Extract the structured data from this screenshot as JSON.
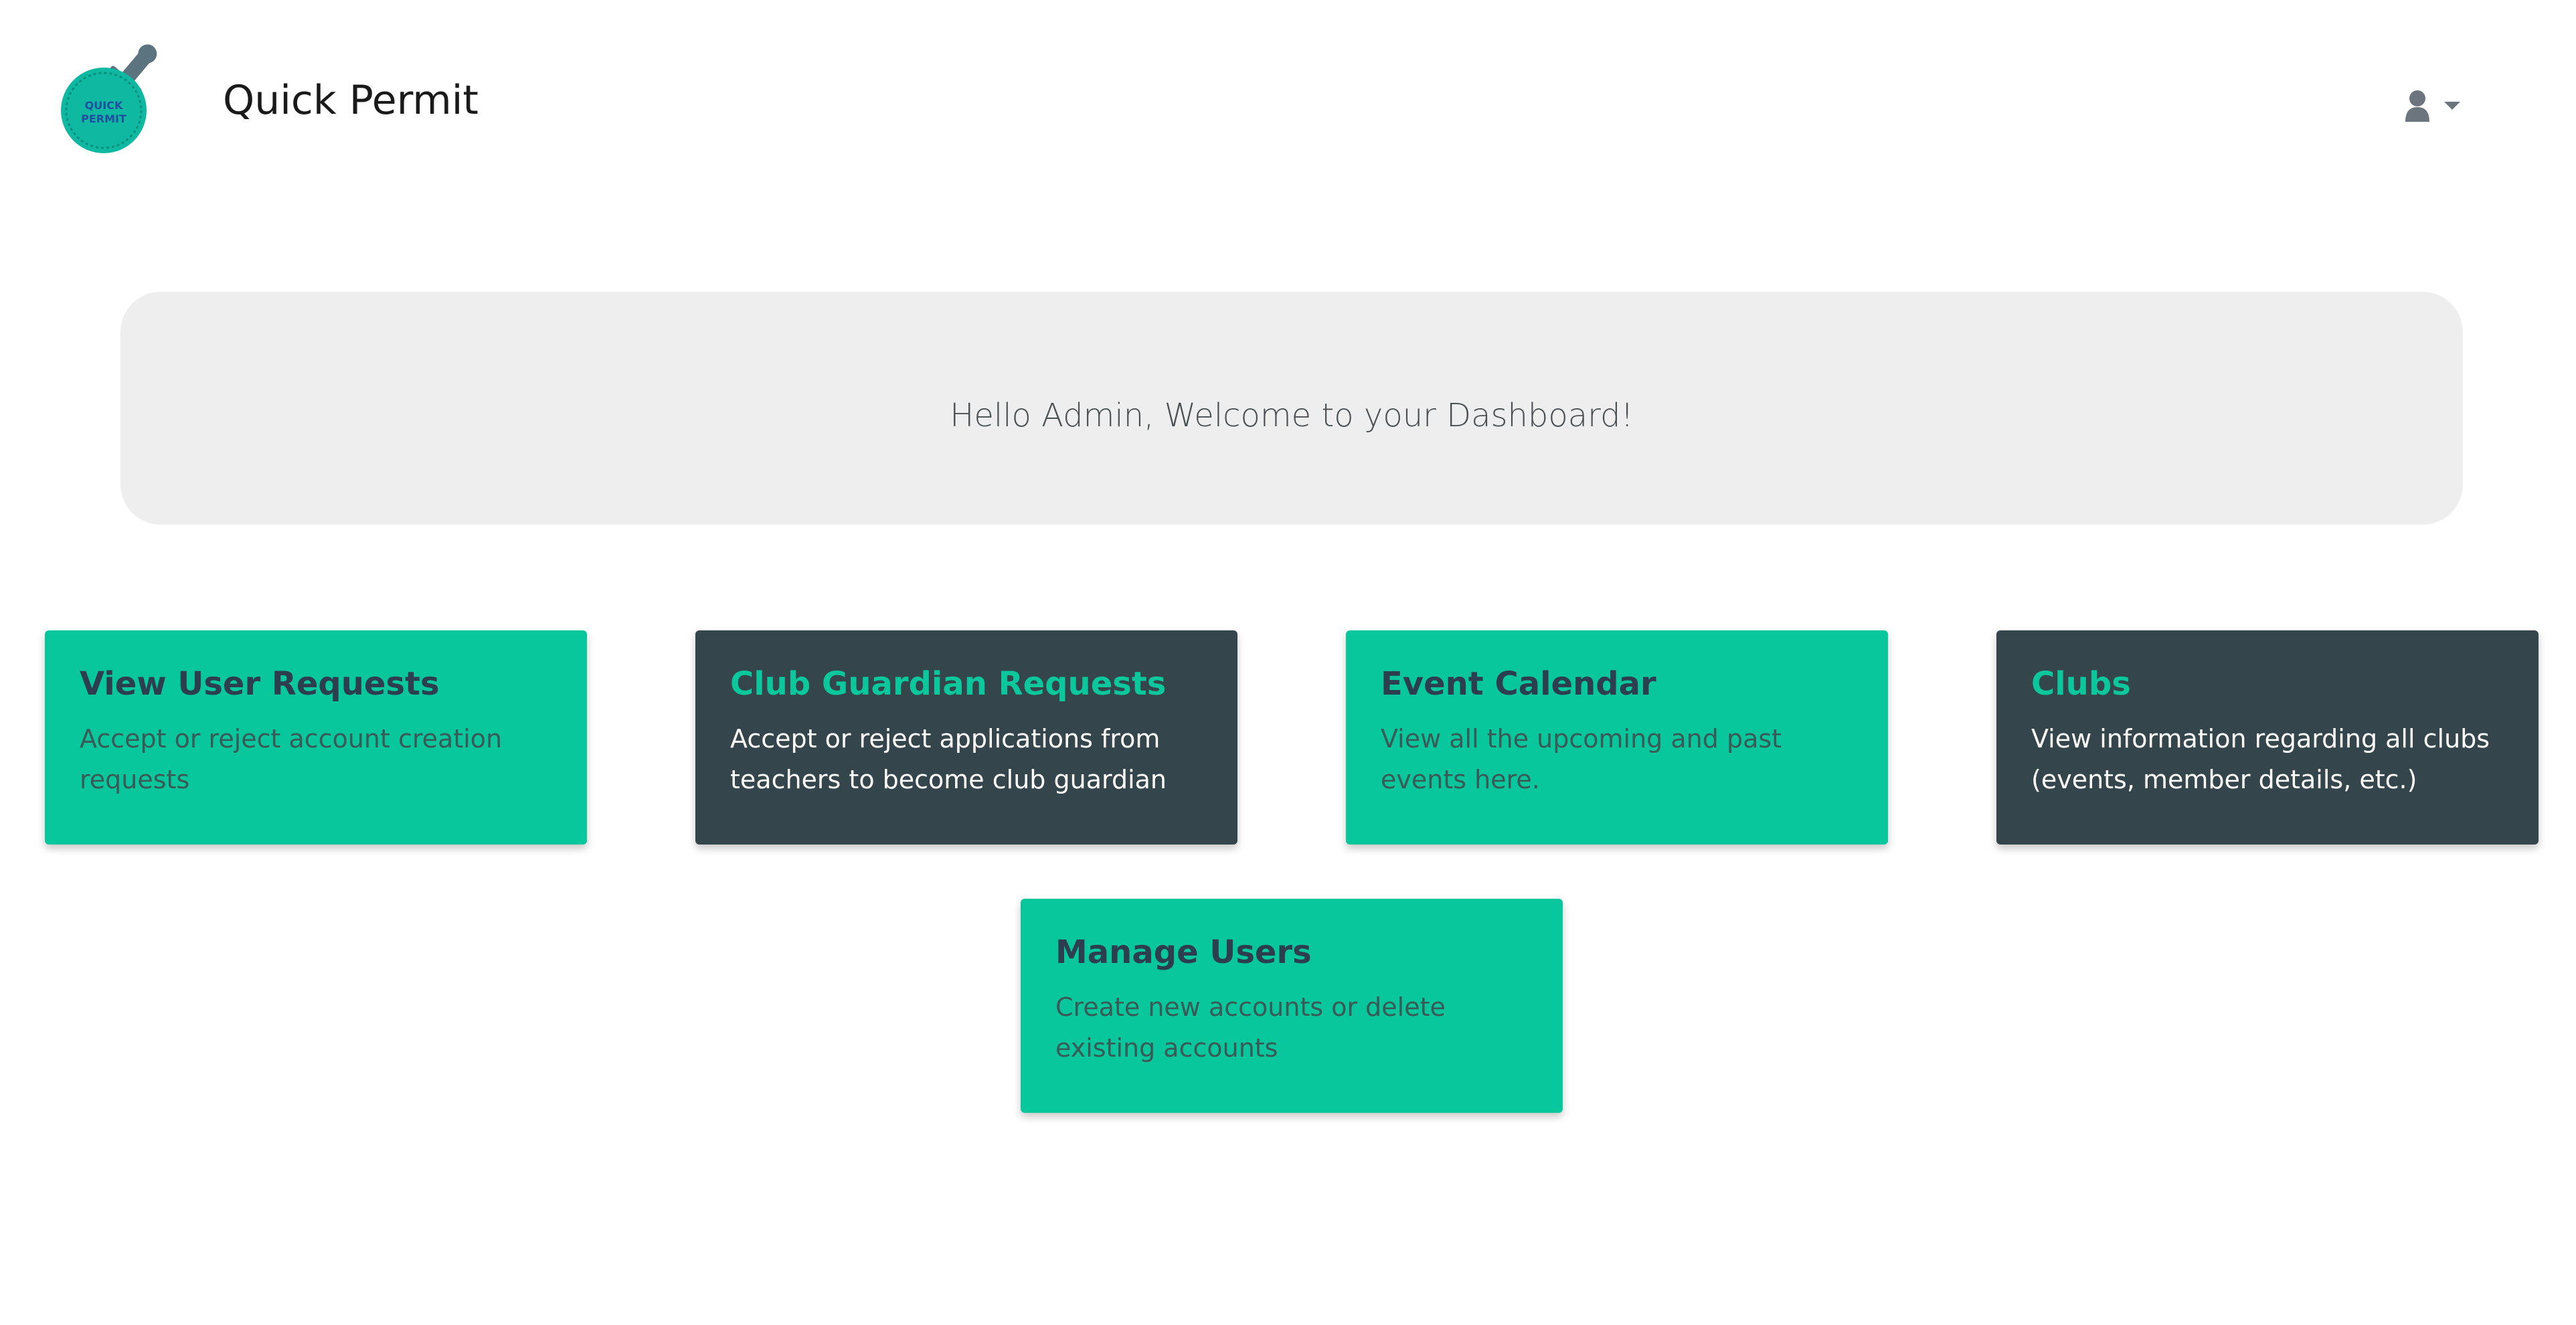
{
  "navbar": {
    "brand_name": "Quick Permit",
    "logo_text_line1": "QUICK",
    "logo_text_line2": "PERMIT",
    "user_icon": "user-icon",
    "caret_icon": "caret-down-icon"
  },
  "welcome": {
    "message": "Hello Admin, Welcome to your Dashboard!"
  },
  "cards": [
    {
      "title": "View User Requests",
      "description": "Accept or reject account creation requests",
      "theme": "light"
    },
    {
      "title": "Club Guardian Requests",
      "description": "Accept or reject applications from teachers to become club guardian",
      "theme": "dark"
    },
    {
      "title": "Event Calendar",
      "description": "View all the upcoming and past events here.",
      "theme": "light"
    },
    {
      "title": "Clubs",
      "description": "View information regarding all clubs (events, member details, etc.)",
      "theme": "dark"
    },
    {
      "title": "Manage Users",
      "description": "Create new accounts or delete existing accounts",
      "theme": "light"
    }
  ],
  "colors": {
    "accent_green": "#09c79c",
    "dark_slate": "#35454c",
    "panel_gray": "#eeeeee"
  }
}
